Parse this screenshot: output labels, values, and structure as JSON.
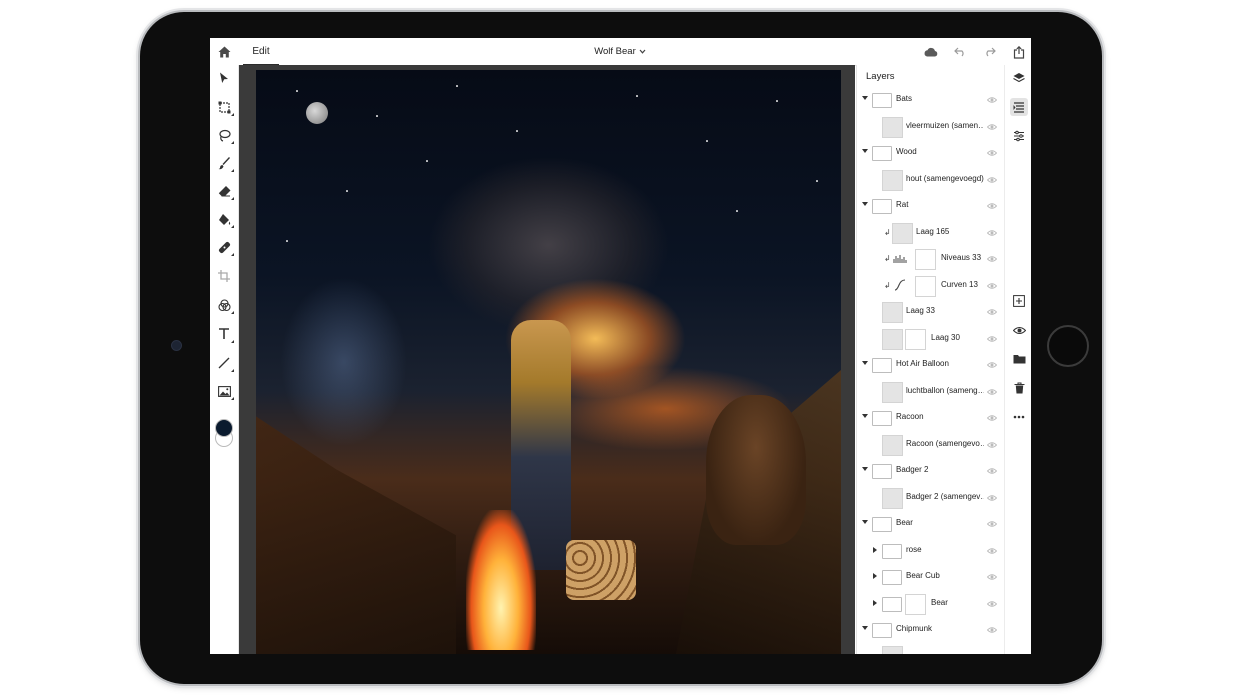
{
  "topbar": {
    "home_icon": "home-icon",
    "tab_edit": "Edit",
    "document_title": "Wolf Bear",
    "icons": [
      "cloud-icon",
      "undo-icon",
      "redo-icon",
      "share-icon"
    ]
  },
  "tools": [
    "select-icon",
    "transform-icon",
    "lasso-icon",
    "brush-icon",
    "eraser-icon",
    "fill-icon",
    "healing-icon",
    "crop-icon",
    "adjust-icon",
    "type-icon",
    "line-icon",
    "image-icon"
  ],
  "colors": {
    "foreground": "#0a1a2e",
    "background": "#ffffff",
    "accent": "#2680eb"
  },
  "layers": {
    "title": "Layers",
    "items": [
      {
        "kind": "group",
        "name": "Bats",
        "expanded": true
      },
      {
        "kind": "layer",
        "name": "vleermuizen (samen…"
      },
      {
        "kind": "group",
        "name": "Wood",
        "expanded": true
      },
      {
        "kind": "layer",
        "name": "hout (samengevoegd)"
      },
      {
        "kind": "group",
        "name": "Rat",
        "expanded": true
      },
      {
        "kind": "clip-layer",
        "name": "Laag 165"
      },
      {
        "kind": "clip-adjust",
        "name": "Niveaus 33",
        "adjust_icon": "levels-icon"
      },
      {
        "kind": "clip-adjust",
        "name": "Curven 13",
        "adjust_icon": "curves-icon"
      },
      {
        "kind": "layer",
        "name": "Laag 33"
      },
      {
        "kind": "masked",
        "name": "Laag 30"
      },
      {
        "kind": "group",
        "name": "Hot Air Balloon",
        "expanded": true
      },
      {
        "kind": "layer",
        "name": "luchtballon (sameng…"
      },
      {
        "kind": "group",
        "name": "Racoon",
        "expanded": true
      },
      {
        "kind": "layer",
        "name": "Racoon (samengevo…"
      },
      {
        "kind": "group",
        "name": "Badger 2",
        "expanded": true
      },
      {
        "kind": "layer",
        "name": "Badger 2 (samengev…"
      },
      {
        "kind": "group",
        "name": "Bear",
        "expanded": true
      },
      {
        "kind": "subgroup",
        "name": "rose"
      },
      {
        "kind": "subgroup",
        "name": "Bear Cub"
      },
      {
        "kind": "subgroup-masked",
        "name": "Bear"
      },
      {
        "kind": "group",
        "name": "Chipmunk",
        "expanded": true
      }
    ]
  },
  "rail": [
    "layers-icon",
    "layer-properties-icon",
    "adjustments-icon",
    "add-layer-icon",
    "visibility-icon",
    "group-icon",
    "delete-icon",
    "more-icon"
  ]
}
